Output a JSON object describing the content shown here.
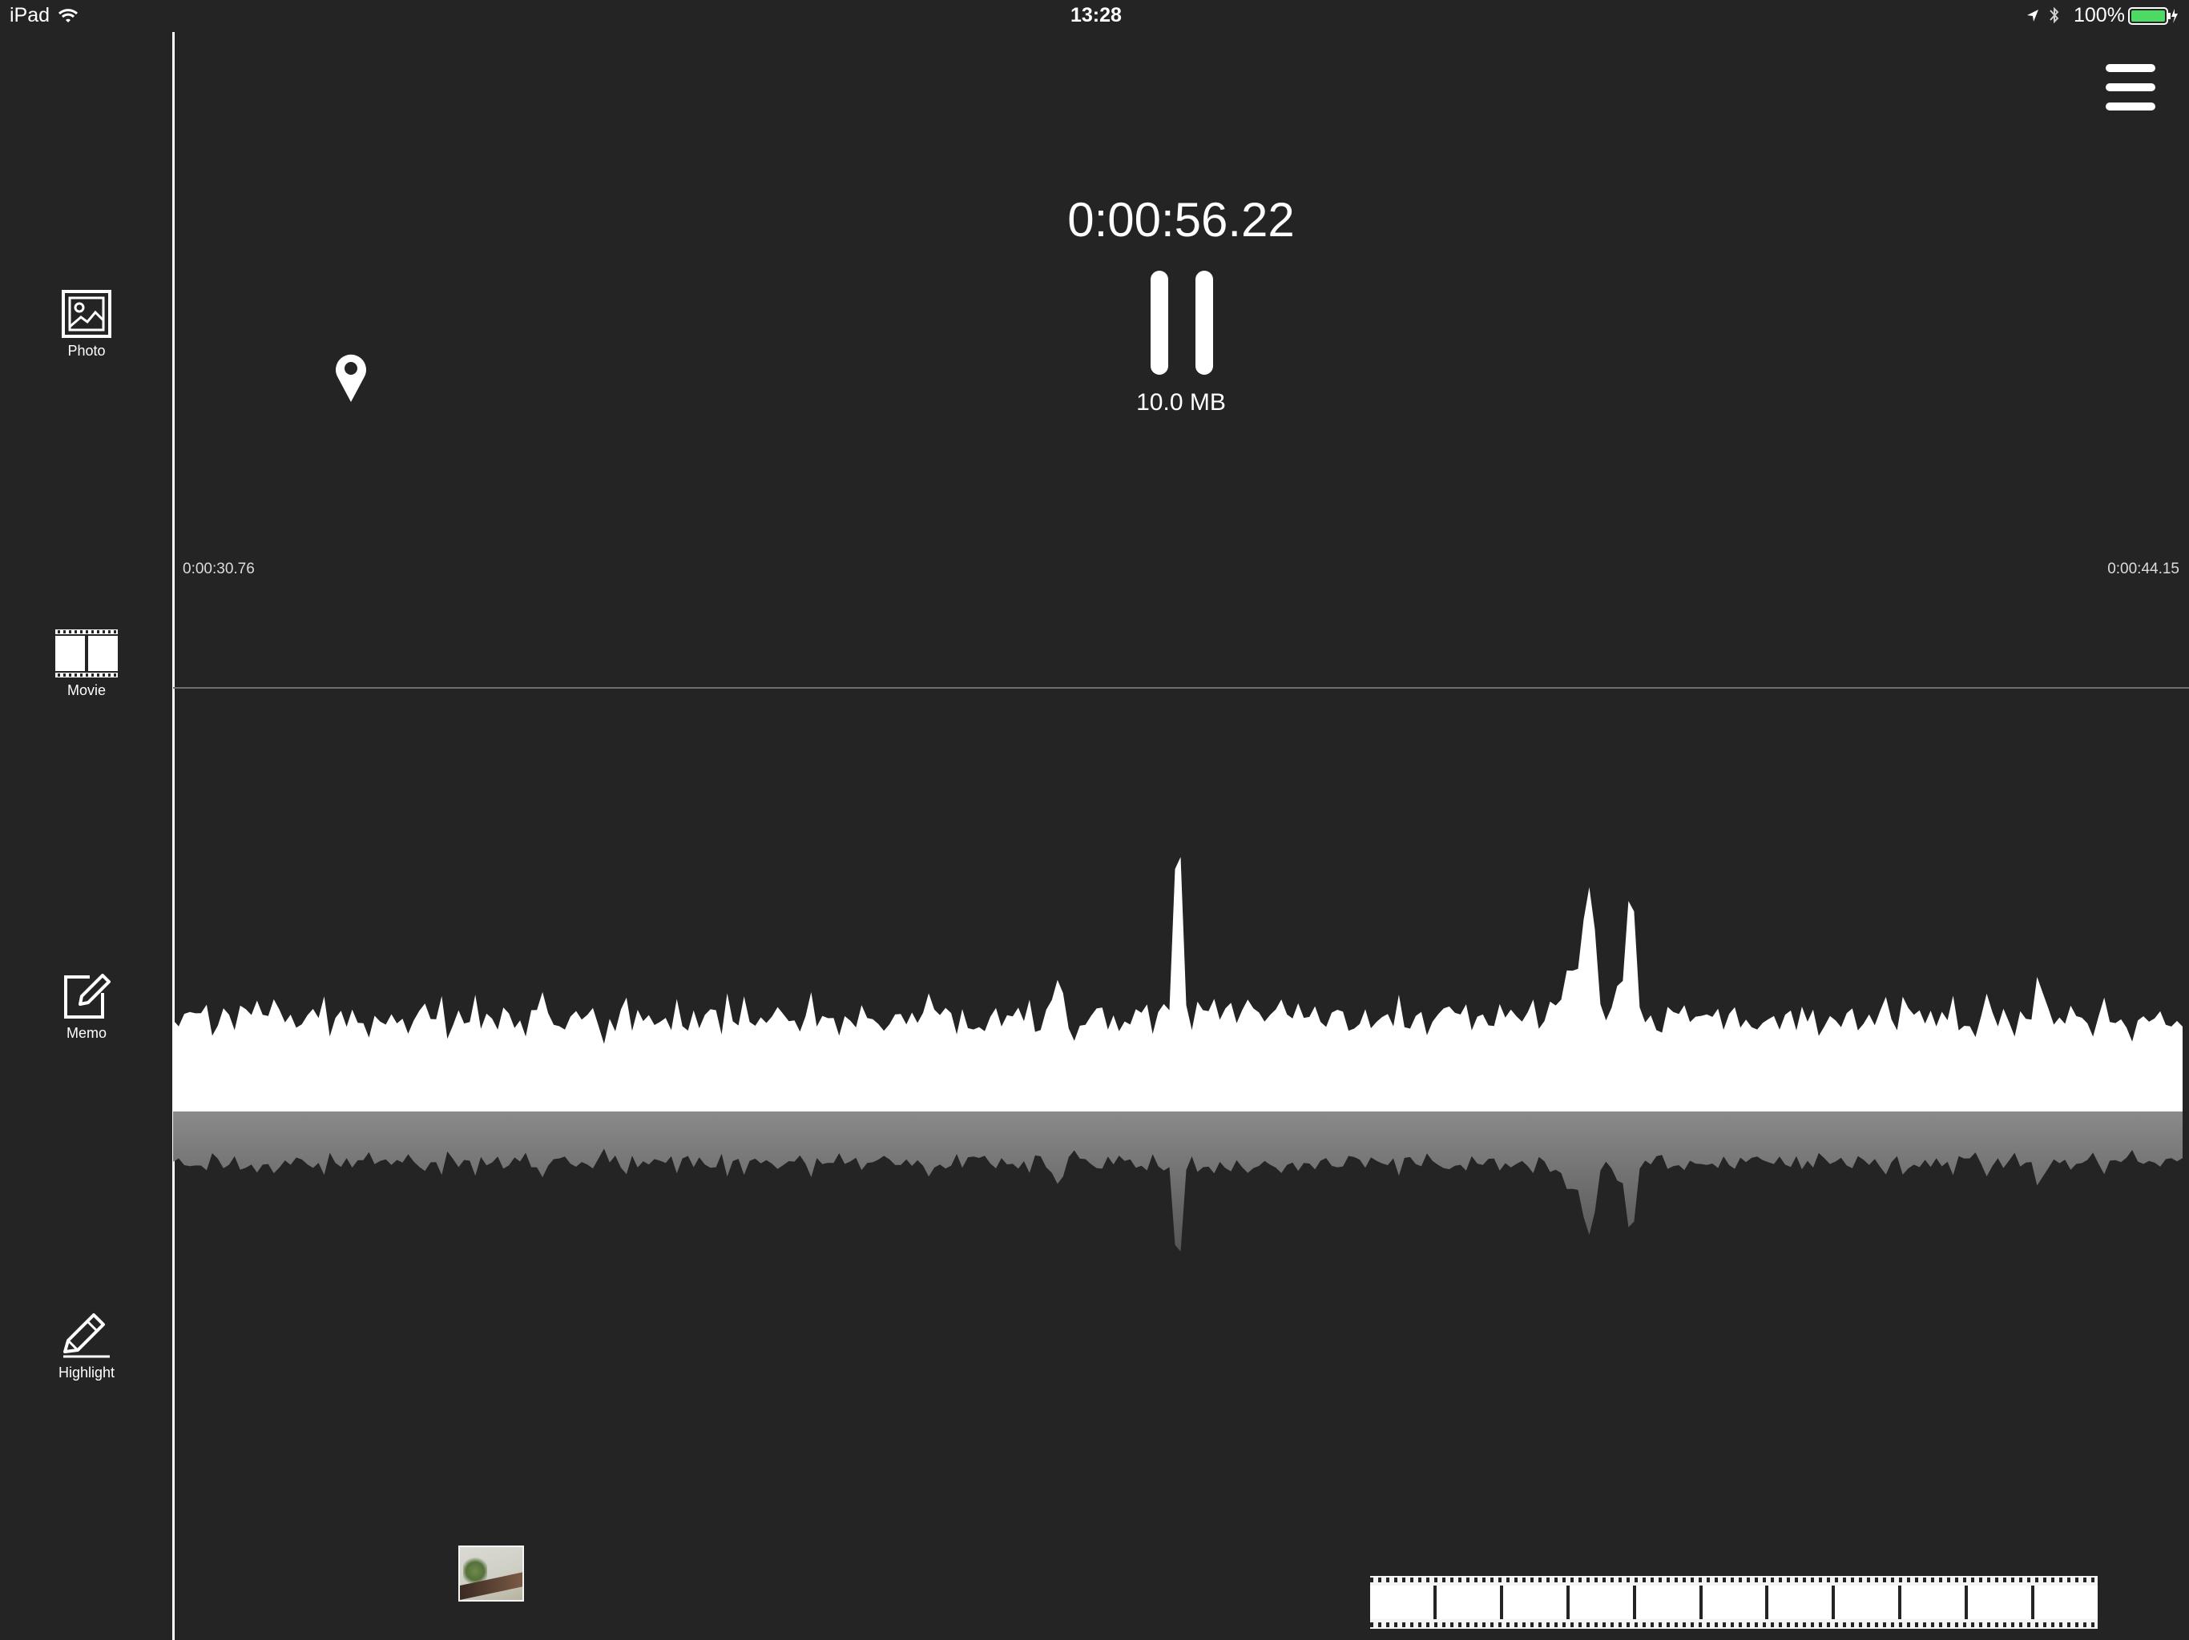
{
  "status_bar": {
    "device": "iPad",
    "time": "13:28",
    "battery": "100%",
    "battery_color": "#4cd964"
  },
  "sidebar": {
    "items": [
      {
        "label": "Photo",
        "icon": "photo-icon"
      },
      {
        "label": "Movie",
        "icon": "film-icon"
      },
      {
        "label": "Memo",
        "icon": "memo-icon"
      },
      {
        "label": "Highlight",
        "icon": "highlight-icon"
      }
    ]
  },
  "menu": {
    "icon": "hamburger-menu-icon"
  },
  "recorder": {
    "elapsed": "0:00:56.22",
    "file_size": "10.0 MB",
    "control": "pause-icon"
  },
  "timeline": {
    "start_time": "0:00:30.76",
    "end_time": "0:00:44.15",
    "location_pin": "location-pin-icon"
  },
  "attachments": {
    "photo_thumbnail": "photo-thumbnail",
    "movie_strip_icon": "film-strip"
  },
  "colors": {
    "background": "#242424",
    "waveform": "#ffffff",
    "reflection": "#7a7a7a"
  }
}
